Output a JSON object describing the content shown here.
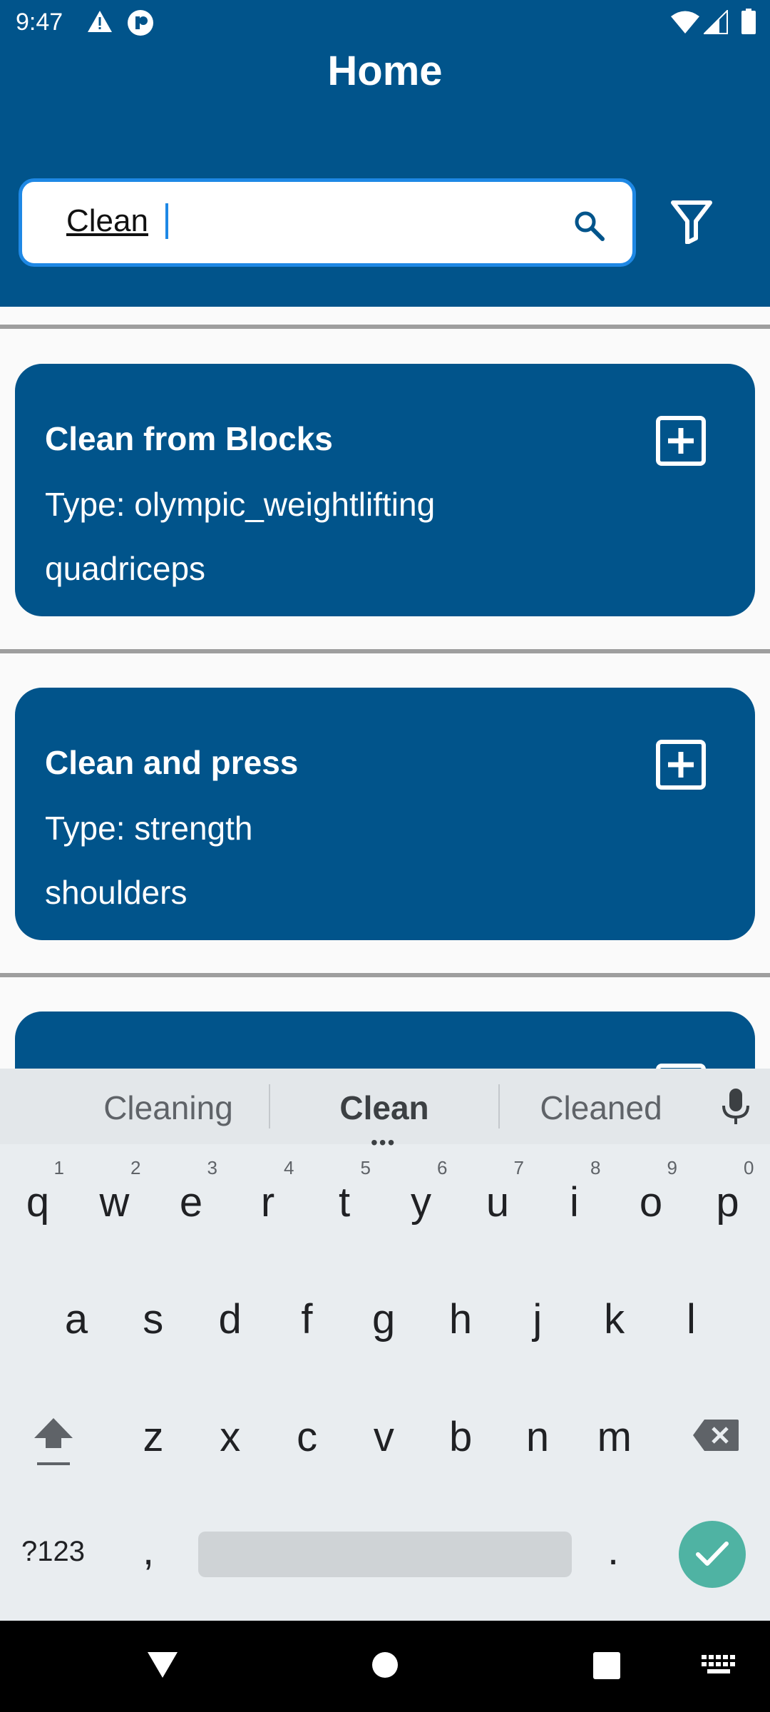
{
  "status": {
    "time": "9:47"
  },
  "header": {
    "title": "Home"
  },
  "search": {
    "value": "Clean"
  },
  "exercises": [
    {
      "name": "Clean from Blocks",
      "type": "Type: olympic_weightlifting",
      "muscle": "quadriceps"
    },
    {
      "name": "Clean and press",
      "type": "Type: strength",
      "muscle": "shoulders"
    }
  ],
  "keyboard": {
    "suggestions": [
      "Cleaning",
      "Clean",
      "Cleaned"
    ],
    "row1": [
      {
        "ch": "q",
        "num": "1"
      },
      {
        "ch": "w",
        "num": "2"
      },
      {
        "ch": "e",
        "num": "3"
      },
      {
        "ch": "r",
        "num": "4"
      },
      {
        "ch": "t",
        "num": "5"
      },
      {
        "ch": "y",
        "num": "6"
      },
      {
        "ch": "u",
        "num": "7"
      },
      {
        "ch": "i",
        "num": "8"
      },
      {
        "ch": "o",
        "num": "9"
      },
      {
        "ch": "p",
        "num": "0"
      }
    ],
    "row2": [
      "a",
      "s",
      "d",
      "f",
      "g",
      "h",
      "j",
      "k",
      "l"
    ],
    "row3": [
      "z",
      "x",
      "c",
      "v",
      "b",
      "n",
      "m"
    ],
    "symbols_label": "?123",
    "comma": ",",
    "period": "."
  },
  "colors": {
    "primary": "#01548b",
    "focus": "#1e88e5",
    "enter": "#4fb3a3"
  },
  "icons": [
    "warning-icon",
    "app-notification-icon",
    "wifi-icon",
    "signal-icon",
    "battery-icon",
    "search-icon",
    "filter-icon",
    "add-box-icon",
    "mic-icon",
    "shift-icon",
    "backspace-icon",
    "check-icon",
    "nav-back-icon",
    "nav-home-icon",
    "nav-recents-icon",
    "keyboard-switch-icon"
  ]
}
